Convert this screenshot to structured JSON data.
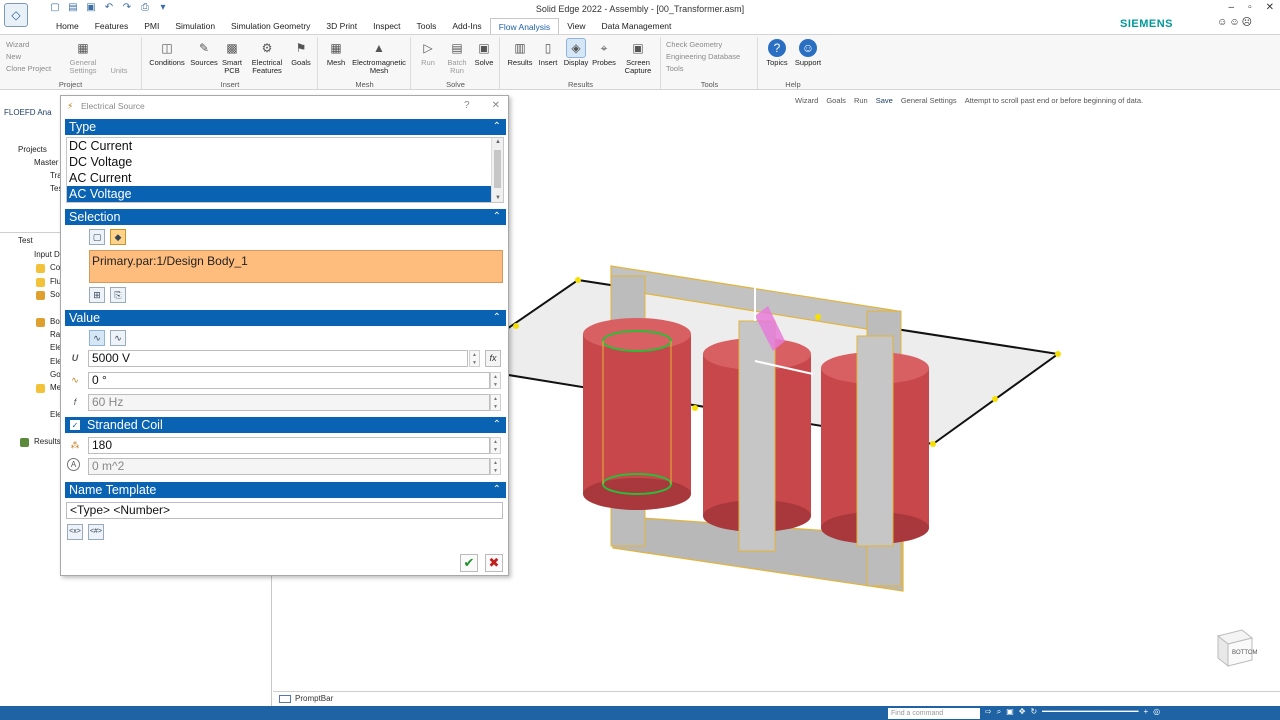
{
  "window": {
    "title": "Solid Edge 2022 - Assembly - [00_Transformer.asm]",
    "brand": "SIEMENS",
    "controls": [
      "–",
      "▫",
      "✕"
    ]
  },
  "ribbon": {
    "tabs": [
      "Home",
      "Features",
      "PMI",
      "Simulation",
      "Simulation Geometry",
      "3D Print",
      "Inspect",
      "Tools",
      "Add-Ins",
      "Flow Analysis",
      "View",
      "Data Management"
    ],
    "active_tab": "Flow Analysis",
    "project": {
      "label": "Project",
      "wizard": "Wizard",
      "new": "New",
      "clone_project": "Clone Project",
      "general_settings": "General Settings",
      "units": "Units"
    },
    "insert": {
      "label": "Insert",
      "conditions": "Conditions",
      "sources": "Sources",
      "smart_pcb": "Smart PCB",
      "electrical_features": "Electrical Features",
      "goals": "Goals"
    },
    "mesh": {
      "label": "Mesh",
      "mesh": "Mesh",
      "electromagnetic_mesh": "Electromagnetic Mesh"
    },
    "solve": {
      "label": "Solve",
      "run": "Run",
      "batch_run": "Batch Run",
      "solve": "Solve"
    },
    "results": {
      "label": "Results",
      "results": "Results",
      "insert": "Insert",
      "display": "Display",
      "probes": "Probes",
      "screen_capture": "Screen Capture"
    },
    "tools": {
      "label": "Tools",
      "check_geometry": "Check Geometry",
      "engineering_database": "Engineering Database",
      "tools": "Tools"
    },
    "help": {
      "label": "Help",
      "topics": "Topics",
      "support": "Support"
    }
  },
  "command_bar": {
    "wizard": "Wizard",
    "goals": "Goals",
    "run": "Run",
    "save": "Save",
    "general_settings": "General Settings",
    "message": "Attempt to scroll past end or before beginning of data."
  },
  "feature_manager": {
    "header": "FLOEFD Ana",
    "projects_label": "Projects",
    "master_label": "Master",
    "tree_top": [
      "Tra",
      "Tes"
    ],
    "test_label": "Test",
    "input_data": "Input D",
    "tree_items": [
      "Co",
      "Flu",
      "Sol",
      "",
      "Bo",
      "Ra",
      "Ele",
      "Ele",
      "Go",
      "Me",
      "",
      "Ele",
      ""
    ],
    "results": "Results"
  },
  "dialog": {
    "title": "Electrical Source",
    "help": "?",
    "close": "✕",
    "type_section": "Type",
    "type_options": [
      "DC Current",
      "DC Voltage",
      "AC Current",
      "AC Voltage"
    ],
    "selected_type": "AC Voltage",
    "selection_section": "Selection",
    "selection_value": "Primary.par:1/Design Body_1",
    "value_section": "Value",
    "voltage": "5000 V",
    "phase": "0 °",
    "frequency": "60 Hz",
    "voltage_symbol": "U",
    "frequency_symbol": "f",
    "fx_label": "fx",
    "stranded_section": "Stranded Coil",
    "turns": "180",
    "area": "0 m^2",
    "area_symbol": "A",
    "name_template_section": "Name Template",
    "name_template_value": "<Type> <Number>",
    "token_x": "<x>",
    "token_hash": "<#>"
  },
  "viewport": {
    "nav_cube_label": "BOTTOM"
  },
  "prompt_bar": {
    "label": "PromptBar"
  },
  "status_bar": {
    "find_command_placeholder": "Find a command"
  },
  "colors": {
    "accent": "#0A62B3",
    "selection": "#FFBD7D",
    "coil": "#C8474A",
    "core": "#B5B5B5",
    "highlight": "#F2C23A"
  }
}
